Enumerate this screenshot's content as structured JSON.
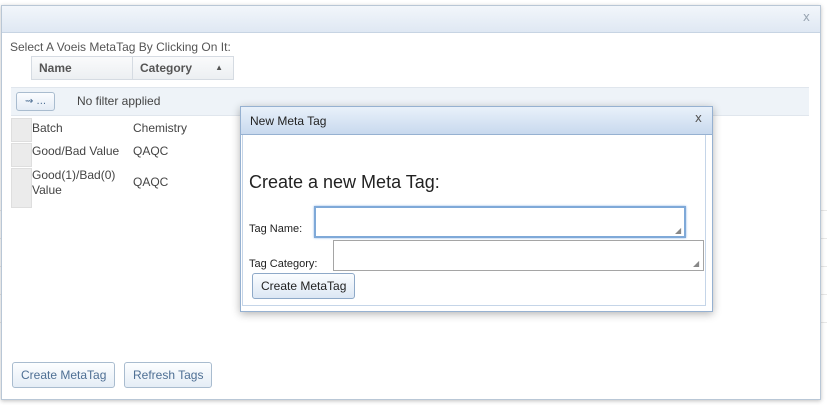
{
  "outer_dialog": {
    "close_glyph": "x",
    "instruction": "Select A Voeis MetaTag By Clicking On It:"
  },
  "grid": {
    "columns": [
      "Name",
      "Category"
    ],
    "sort_glyph": "▲",
    "filter_button_label": "⇝ ...",
    "filter_status": "No filter applied",
    "rows": [
      {
        "name": "Batch",
        "category": "Chemistry"
      },
      {
        "name": "Good/Bad Value",
        "category": "QAQC"
      },
      {
        "name": "Good(1)/Bad(0) Value",
        "category": "QAQC"
      }
    ]
  },
  "footer": {
    "create_label": "Create MetaTag",
    "refresh_label": "Refresh Tags"
  },
  "modal": {
    "title": "New Meta Tag",
    "close_glyph": "x",
    "heading": "Create a new Meta Tag:",
    "tag_name_label": "Tag Name:",
    "tag_name_value": "",
    "tag_category_label": "Tag Category:",
    "tag_category_value": "",
    "create_button_label": "Create MetaTag"
  },
  "colors": {
    "titlebar": "#dfe8f3",
    "modal_titlebar": "#c8d9ee",
    "button_text": "#4e6f94",
    "focus_border": "#7fa9d8"
  }
}
